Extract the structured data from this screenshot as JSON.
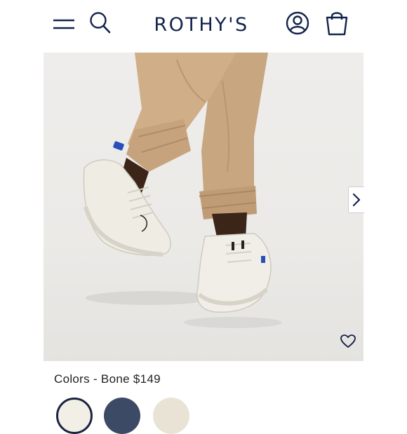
{
  "header": {
    "logo": "ROTHY'S",
    "icons": [
      "hamburger-menu-icon",
      "search-icon",
      "account-icon",
      "shopping-bag-icon"
    ]
  },
  "hero": {
    "next_icon": "chevron-right-icon",
    "wishlist_icon": "heart-icon"
  },
  "product": {
    "colors_label": "Colors - Bone $149"
  },
  "swatches": [
    {
      "color": "#f2efe7",
      "selected": true
    },
    {
      "color": "#3c4a66",
      "selected": false
    },
    {
      "color": "#e9e3d5",
      "selected": false
    }
  ],
  "colors": {
    "brand": "#14234b",
    "pants": "#c9a882",
    "shoe": "#efece4",
    "accent_blue": "#2b4fb8"
  }
}
